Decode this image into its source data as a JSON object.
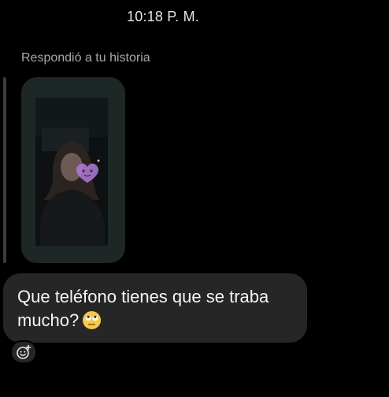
{
  "chat": {
    "timestamp": "10:18 P. M.",
    "reply_label": "Respondió a tu historia",
    "message": {
      "text": "Que teléfono tienes que se traba mucho?",
      "emoji": "face-with-rolling-eyes"
    },
    "reaction_button_icon": "add-reaction-icon"
  },
  "colors": {
    "background": "#000000",
    "bubble": "#262626",
    "story_card": "#1d2826",
    "reply_line": "#3c3c3c",
    "sticker_heart": "#b07ad8"
  }
}
